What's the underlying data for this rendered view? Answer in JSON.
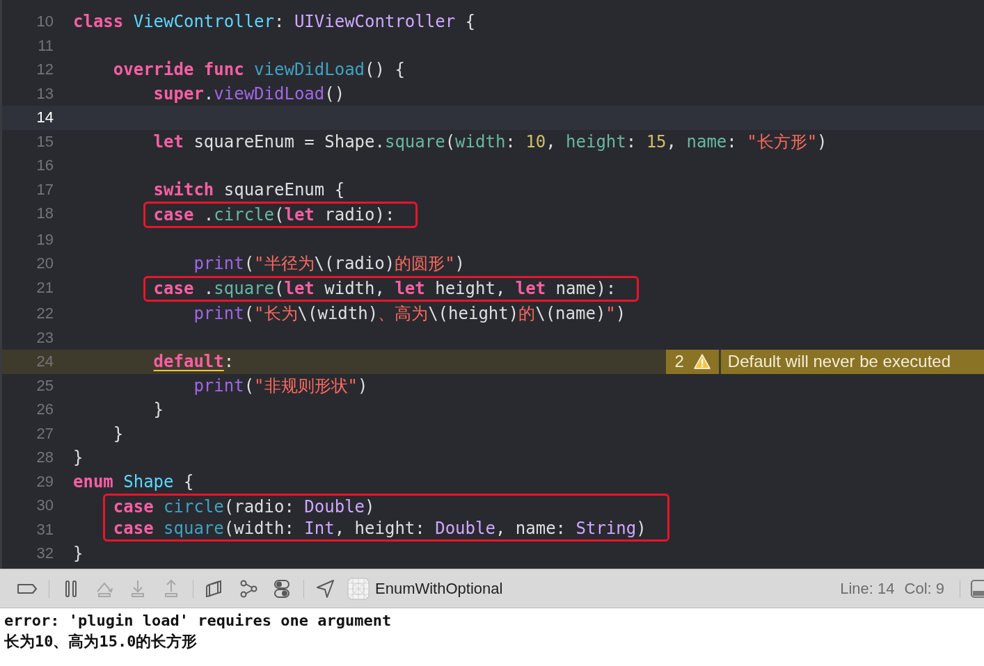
{
  "editor": {
    "lines": [
      {
        "number": "10",
        "current": false,
        "tokens": [
          {
            "kind": "keyword",
            "text": "class"
          },
          {
            "kind": "type_decl",
            "text": " ViewController"
          },
          {
            "kind": "plain",
            "text": ": "
          },
          {
            "kind": "type",
            "text": "UIViewController"
          },
          {
            "kind": "plain",
            "text": " {"
          }
        ],
        "children": [
          {
            "number": "11",
            "current": false
          },
          {
            "number": "12",
            "current": false,
            "tokens": [
              {
                "kind": "keyword",
                "text": "override func"
              },
              {
                "kind": "func_decl",
                "text": " viewDidLoad"
              },
              {
                "kind": "plain",
                "text": "() {"
              }
            ],
            "children": [
              {
                "number": "13",
                "current": false,
                "tokens": [
                  {
                    "kind": "keyword",
                    "text": "super"
                  },
                  {
                    "kind": "plain",
                    "text": "."
                  },
                  {
                    "kind": "call",
                    "text": "viewDidLoad"
                  },
                  {
                    "kind": "plain",
                    "text": "()"
                  }
                ]
              },
              {
                "number": "14",
                "current": true
              },
              {
                "number": "15",
                "current": false,
                "tokens": [
                  {
                    "kind": "keyword",
                    "text": "let"
                  },
                  {
                    "kind": "plain",
                    "text": " squareEnum = Shape."
                  },
                  {
                    "kind": "member",
                    "text": "square"
                  },
                  {
                    "kind": "plain",
                    "text": "("
                  },
                  {
                    "kind": "member",
                    "text": "width"
                  },
                  {
                    "kind": "plain",
                    "text": ": "
                  },
                  {
                    "kind": "number",
                    "text": "10"
                  },
                  {
                    "kind": "plain",
                    "text": ", "
                  },
                  {
                    "kind": "member",
                    "text": "height"
                  },
                  {
                    "kind": "plain",
                    "text": ": "
                  },
                  {
                    "kind": "number",
                    "text": "15"
                  },
                  {
                    "kind": "plain",
                    "text": ", "
                  },
                  {
                    "kind": "member",
                    "text": "name"
                  },
                  {
                    "kind": "plain",
                    "text": ": "
                  },
                  {
                    "kind": "string",
                    "text": "\"长方形\""
                  },
                  {
                    "kind": "plain",
                    "text": ")"
                  }
                ]
              },
              {
                "number": "16",
                "current": false
              },
              {
                "number": "17",
                "current": false,
                "tokens": [
                  {
                    "kind": "keyword",
                    "text": "switch"
                  },
                  {
                    "kind": "plain",
                    "text": " squareEnum {"
                  }
                ]
              },
              {
                "number": "18",
                "current": false,
                "boxed": true,
                "tokens": [
                  {
                    "kind": "keyword",
                    "text": "case"
                  },
                  {
                    "kind": "plain",
                    "text": " ."
                  },
                  {
                    "kind": "member",
                    "text": "circle"
                  },
                  {
                    "kind": "plain",
                    "text": "("
                  },
                  {
                    "kind": "keyword",
                    "text": "let"
                  },
                  {
                    "kind": "plain",
                    "text": " radio):"
                  }
                ],
                "children": [
                  {
                    "number": "19",
                    "current": false
                  },
                  {
                    "number": "20",
                    "current": false,
                    "tokens": [
                      {
                        "kind": "call",
                        "text": "print"
                      },
                      {
                        "kind": "plain",
                        "text": "("
                      },
                      {
                        "kind": "string",
                        "text": "\"半径为"
                      },
                      {
                        "kind": "plain",
                        "text": "\\(radio)"
                      },
                      {
                        "kind": "string",
                        "text": "的圆形\""
                      },
                      {
                        "kind": "plain",
                        "text": ")"
                      }
                    ]
                  }
                ]
              },
              {
                "number": "21",
                "current": false,
                "boxed": true,
                "tokens": [
                  {
                    "kind": "keyword",
                    "text": "case"
                  },
                  {
                    "kind": "plain",
                    "text": " ."
                  },
                  {
                    "kind": "member",
                    "text": "square"
                  },
                  {
                    "kind": "plain",
                    "text": "("
                  },
                  {
                    "kind": "keyword",
                    "text": "let"
                  },
                  {
                    "kind": "plain",
                    "text": " width, "
                  },
                  {
                    "kind": "keyword",
                    "text": "let"
                  },
                  {
                    "kind": "plain",
                    "text": " height, "
                  },
                  {
                    "kind": "keyword",
                    "text": "let"
                  },
                  {
                    "kind": "plain",
                    "text": " name):"
                  }
                ],
                "children": [
                  {
                    "number": "22",
                    "current": false,
                    "tokens": [
                      {
                        "kind": "call",
                        "text": "print"
                      },
                      {
                        "kind": "plain",
                        "text": "("
                      },
                      {
                        "kind": "string",
                        "text": "\"长为"
                      },
                      {
                        "kind": "plain",
                        "text": "\\(width)"
                      },
                      {
                        "kind": "string",
                        "text": "、高为"
                      },
                      {
                        "kind": "plain",
                        "text": "\\(height)"
                      },
                      {
                        "kind": "string",
                        "text": "的"
                      },
                      {
                        "kind": "plain",
                        "text": "\\(name)"
                      },
                      {
                        "kind": "string",
                        "text": "\""
                      },
                      {
                        "kind": "plain",
                        "text": ")"
                      }
                    ]
                  },
                  {
                    "number": "23",
                    "current": false
                  }
                ]
              },
              {
                "number": "24",
                "current": false,
                "warning": {
                  "count": "2",
                  "message": "Default will never be executed"
                },
                "tokens": [
                  {
                    "kind": "keyword",
                    "text": "default"
                  },
                  {
                    "kind": "plain",
                    "text": ":"
                  }
                ],
                "children": [
                  {
                    "number": "25",
                    "current": false,
                    "tokens": [
                      {
                        "kind": "call",
                        "text": "print"
                      },
                      {
                        "kind": "plain",
                        "text": "("
                      },
                      {
                        "kind": "string",
                        "text": "\"非规则形状\""
                      },
                      {
                        "kind": "plain",
                        "text": ")"
                      }
                    ]
                  }
                ]
              },
              {
                "number": "26",
                "current": false,
                "tokens": [
                  {
                    "kind": "plain",
                    "text": "}"
                  }
                ]
              }
            ]
          },
          {
            "number": "27",
            "current": false,
            "tokens": [
              {
                "kind": "plain",
                "text": "}"
              }
            ]
          }
        ]
      },
      {
        "number": "28",
        "current": false,
        "tokens": [
          {
            "kind": "plain",
            "text": "}"
          }
        ]
      },
      {
        "number": "29",
        "current": false,
        "tokens": [
          {
            "kind": "keyword",
            "text": "enum"
          },
          {
            "kind": "type_decl",
            "text": " Shape"
          },
          {
            "kind": "plain",
            "text": " {"
          }
        ],
        "children": [
          {
            "number": "30",
            "current": false,
            "boxed": true,
            "tokens": [
              {
                "kind": "keyword",
                "text": "case"
              },
              {
                "kind": "func_decl",
                "text": " circle"
              },
              {
                "kind": "plain",
                "text": "(radio: "
              },
              {
                "kind": "type",
                "text": "Double"
              },
              {
                "kind": "plain",
                "text": ")"
              }
            ]
          },
          {
            "number": "31",
            "current": false,
            "boxed": true,
            "tokens": [
              {
                "kind": "keyword",
                "text": "case"
              },
              {
                "kind": "func_decl",
                "text": " square"
              },
              {
                "kind": "plain",
                "text": "(width: "
              },
              {
                "kind": "type",
                "text": "Int"
              },
              {
                "kind": "plain",
                "text": ", height: "
              },
              {
                "kind": "type",
                "text": "Double"
              },
              {
                "kind": "plain",
                "text": ", name: "
              },
              {
                "kind": "type",
                "text": "String"
              },
              {
                "kind": "plain",
                "text": ")"
              }
            ]
          }
        ]
      },
      {
        "number": "32",
        "current": false,
        "tokens": [
          {
            "kind": "plain",
            "text": "}"
          }
        ]
      }
    ]
  },
  "debug_bar": {
    "buttons": [
      {
        "kind": "breakpoints",
        "disabled": false
      },
      {
        "kind": "pause",
        "disabled": false
      },
      {
        "kind": "step_over",
        "disabled": true
      },
      {
        "kind": "step_into",
        "disabled": true
      },
      {
        "kind": "step_out",
        "disabled": true
      },
      {
        "kind": "view_debugger",
        "disabled": false
      },
      {
        "kind": "memory_graph",
        "disabled": false
      },
      {
        "kind": "environment",
        "disabled": false
      },
      {
        "kind": "location",
        "disabled": false
      }
    ],
    "target": "EnumWithOptional",
    "line": "Line: 14",
    "col": "Col: 9"
  },
  "console": [
    "error: 'plugin load' requires one argument",
    "长为10、高为15.0的长方形"
  ]
}
